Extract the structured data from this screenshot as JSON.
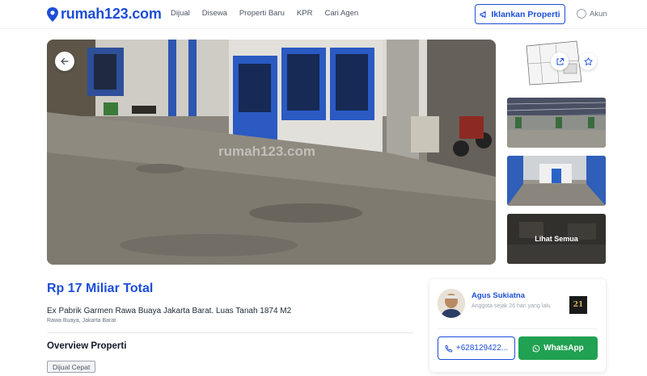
{
  "header": {
    "logo_text": "rumah123.com",
    "nav": [
      "Dijual",
      "Disewa",
      "Properti Baru",
      "KPR",
      "Cari Agen"
    ],
    "cta_label": "Iklankan Properti",
    "account_label": "Akun"
  },
  "gallery": {
    "watermark": "rumah123.com",
    "see_all_label": "Lihat Semua"
  },
  "listing": {
    "price": "Rp 17 Miliar Total",
    "title": "Ex Pabrik Garmen Rawa Buaya Jakarta Barat. Luas Tanah 1874 M2",
    "location": "Rawa Buaya, Jakarta Barat",
    "overview_heading": "Overview Properti",
    "tag": "Dijual Cepat"
  },
  "agent": {
    "name": "Agus Sukiatna",
    "since": "Anggota sejak 26 hari yang lalu",
    "agency_logo_text": "21",
    "phone_label": "+628129422...",
    "whatsapp_label": "WhatsApp"
  },
  "colors": {
    "brand": "#1d4ed8",
    "whatsapp": "#21a152"
  }
}
